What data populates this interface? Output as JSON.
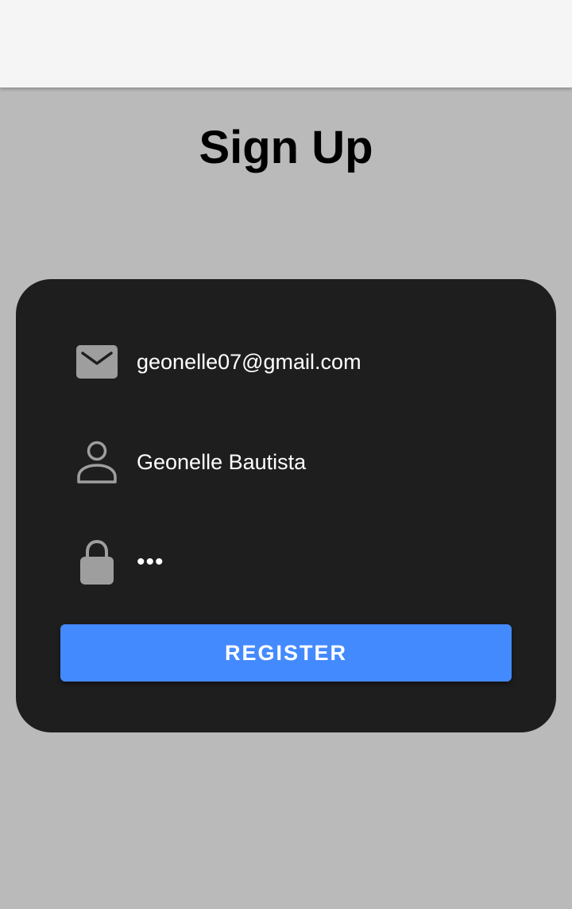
{
  "page": {
    "title": "Sign Up"
  },
  "form": {
    "email": {
      "value": "geonelle07@gmail.com",
      "icon": "email-icon"
    },
    "name": {
      "value": "Geonelle Bautista",
      "icon": "person-icon"
    },
    "password": {
      "value": "•••",
      "icon": "lock-icon"
    },
    "register_label": "REGISTER"
  },
  "colors": {
    "background": "#bababa",
    "app_bar": "#f6f5f5",
    "card": "#1f1e1f",
    "accent": "#448aff",
    "icon": "#9e9e9e"
  }
}
